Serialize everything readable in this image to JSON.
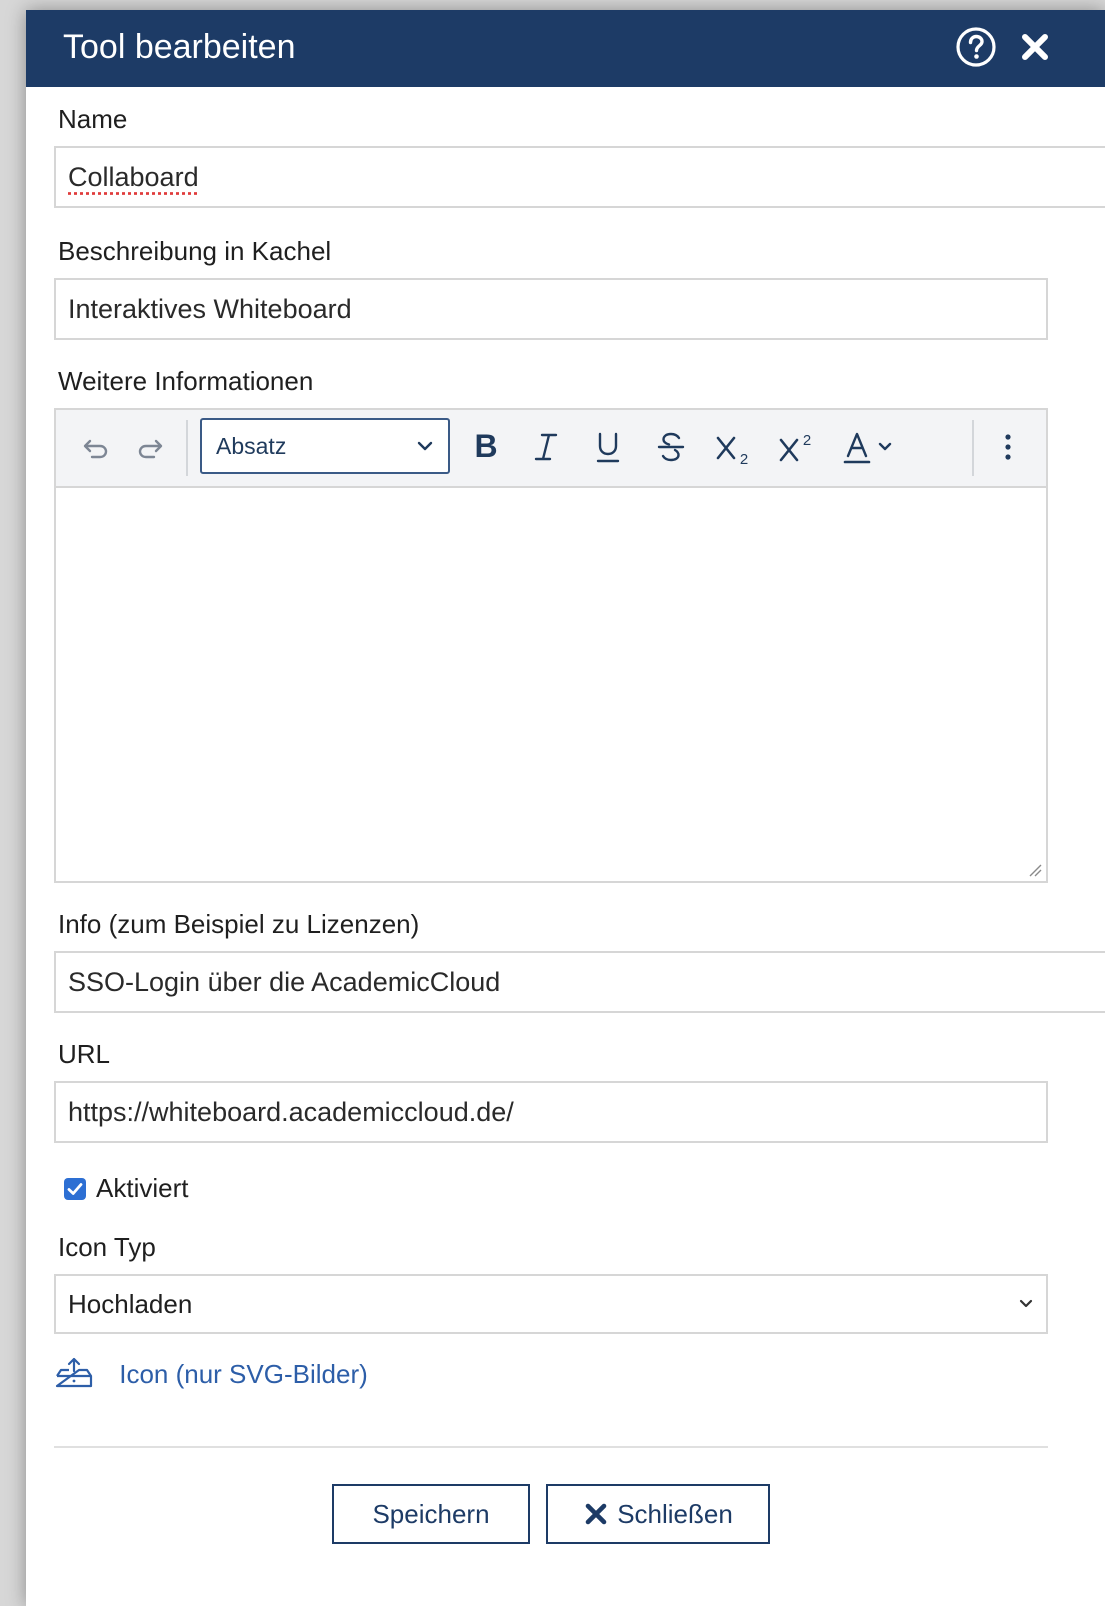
{
  "dialog": {
    "title": "Tool bearbeiten",
    "help_icon": "help-circle-icon",
    "close_icon": "close-icon"
  },
  "form": {
    "name": {
      "label": "Name",
      "value": "Collaboard"
    },
    "description": {
      "label": "Beschreibung in Kachel",
      "value": "Interaktives Whiteboard"
    },
    "more_info": {
      "label": "Weitere Informationen",
      "editor": {
        "block_format": "Absatz",
        "tools": [
          "undo",
          "redo",
          "bold",
          "italic",
          "underline",
          "strikethrough",
          "subscript",
          "superscript",
          "text-color",
          "more"
        ],
        "content": ""
      }
    },
    "info": {
      "label": "Info (zum Beispiel zu Lizenzen)",
      "value": "SSO-Login über die AcademicCloud"
    },
    "url": {
      "label": "URL",
      "value": "https://whiteboard.academiccloud.de/"
    },
    "activated": {
      "label": "Aktiviert",
      "checked": true
    },
    "icon_type": {
      "label": "Icon Typ",
      "selected": "Hochladen"
    },
    "icon_upload": {
      "label": "Icon (nur SVG-Bilder)"
    }
  },
  "footer": {
    "save_label": "Speichern",
    "close_label": "Schließen"
  },
  "colors": {
    "titlebar": "#1d3b66",
    "checkbox": "#2d6fd3",
    "link": "#2d5ea8"
  }
}
